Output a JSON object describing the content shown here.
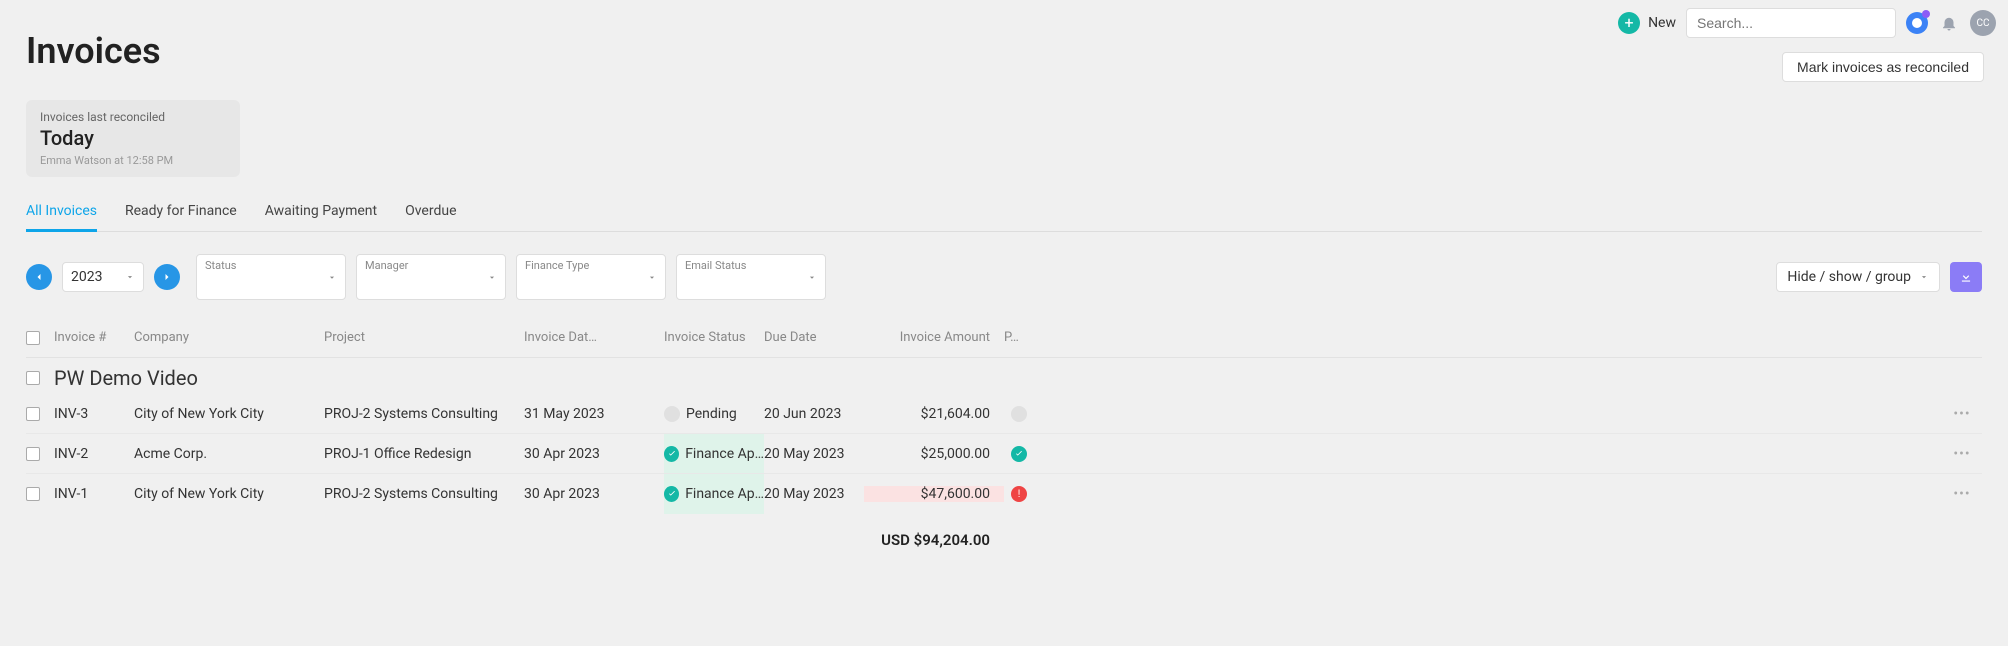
{
  "topbar": {
    "new_label": "New",
    "search_placeholder": "Search...",
    "avatar_initials": "CC"
  },
  "page_title": "Invoices",
  "reconcile_button": "Mark invoices as reconciled",
  "reconciled_card": {
    "label": "Invoices last reconciled",
    "value": "Today",
    "byline": "Emma Watson at 12:58 PM"
  },
  "tabs": [
    {
      "label": "All Invoices",
      "active": true
    },
    {
      "label": "Ready for Finance",
      "active": false
    },
    {
      "label": "Awaiting Payment",
      "active": false
    },
    {
      "label": "Overdue",
      "active": false
    }
  ],
  "filters": {
    "year": "2023",
    "dropdowns": [
      {
        "label": "Status"
      },
      {
        "label": "Manager"
      },
      {
        "label": "Finance Type"
      },
      {
        "label": "Email Status"
      }
    ],
    "hide_show_label": "Hide / show / group"
  },
  "table": {
    "columns": [
      "Invoice #",
      "Company",
      "Project",
      "Invoice Dat…",
      "Invoice Status",
      "Due Date",
      "Invoice Amount",
      "P…"
    ],
    "group_label": "PW Demo Video",
    "rows": [
      {
        "invoice_no": "INV-3",
        "company": "City of New York City",
        "project": "PROJ-2  Systems Consulting",
        "invoice_date": "31 May 2023",
        "status_label": "Pending",
        "status_kind": "pending",
        "due_date": "20 Jun 2023",
        "amount": "$21,604.00",
        "amount_state": "normal",
        "p_state": "grey"
      },
      {
        "invoice_no": "INV-2",
        "company": "Acme Corp.",
        "project": "PROJ-1  Office Redesign",
        "invoice_date": "30 Apr 2023",
        "status_label": "Finance Ap…",
        "status_kind": "approved",
        "due_date": "20 May 2023",
        "amount": "$25,000.00",
        "amount_state": "normal",
        "p_state": "green"
      },
      {
        "invoice_no": "INV-1",
        "company": "City of New York City",
        "project": "PROJ-2  Systems Consulting",
        "invoice_date": "30 Apr 2023",
        "status_label": "Finance Ap…",
        "status_kind": "approved",
        "due_date": "20 May 2023",
        "amount": "$47,600.00",
        "amount_state": "overdue",
        "p_state": "red"
      }
    ],
    "total_label": "USD $94,204.00"
  }
}
